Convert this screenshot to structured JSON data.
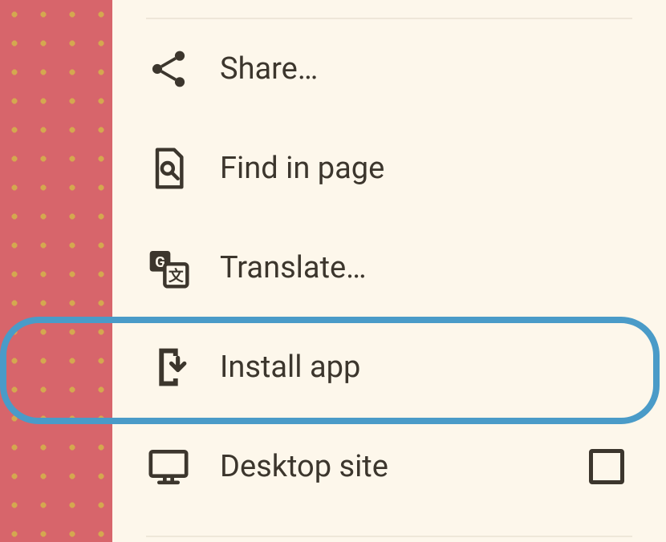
{
  "menu": {
    "items": [
      {
        "id": "share",
        "label": "Share…"
      },
      {
        "id": "find",
        "label": "Find in page"
      },
      {
        "id": "translate",
        "label": "Translate…"
      },
      {
        "id": "install",
        "label": "Install app"
      },
      {
        "id": "desktop",
        "label": "Desktop site",
        "hasCheckbox": true,
        "checked": false
      }
    ],
    "highlighted": "install"
  },
  "colors": {
    "background_panel": "#fdf7eb",
    "background_outer": "#d7656b",
    "dot": "#d4a84f",
    "icon": "#3c362d",
    "text": "#3c362d",
    "highlight_ring": "#4a9bc8"
  }
}
